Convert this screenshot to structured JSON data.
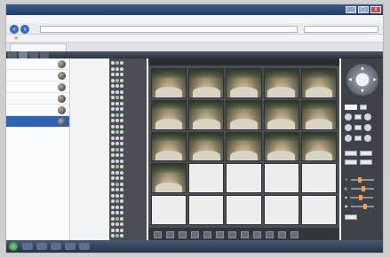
{
  "window": {
    "title": "",
    "controls": [
      "_",
      "□",
      "x"
    ]
  },
  "browser": {
    "menu": [
      "",
      "",
      "",
      "",
      ""
    ],
    "url": "",
    "tab_label": "",
    "commands": [
      "",
      "",
      ""
    ]
  },
  "app": {
    "tabs": [
      {
        "label": "",
        "active": false
      },
      {
        "label": "",
        "active": true
      },
      {
        "label": "",
        "active": false
      },
      {
        "label": "",
        "active": false
      }
    ],
    "devices": [
      {
        "label": ""
      },
      {
        "label": ""
      },
      {
        "label": ""
      },
      {
        "label": ""
      },
      {
        "label": ""
      },
      {
        "label": "",
        "selected": true
      }
    ],
    "viewer_header": [
      "",
      ""
    ],
    "grid": {
      "rows": 5,
      "cols": 5,
      "live_cells": 16
    }
  },
  "colors": {
    "selected": "#2f64b5",
    "dark_panel": "#4a4e54",
    "accent": "#f0a23a"
  },
  "icons": {
    "nav_back": "back-arrow-icon",
    "nav_forward": "forward-arrow-icon",
    "favorites": "star-icon",
    "device": "camera-icon",
    "ptz": "ptz-dpad-icon"
  }
}
